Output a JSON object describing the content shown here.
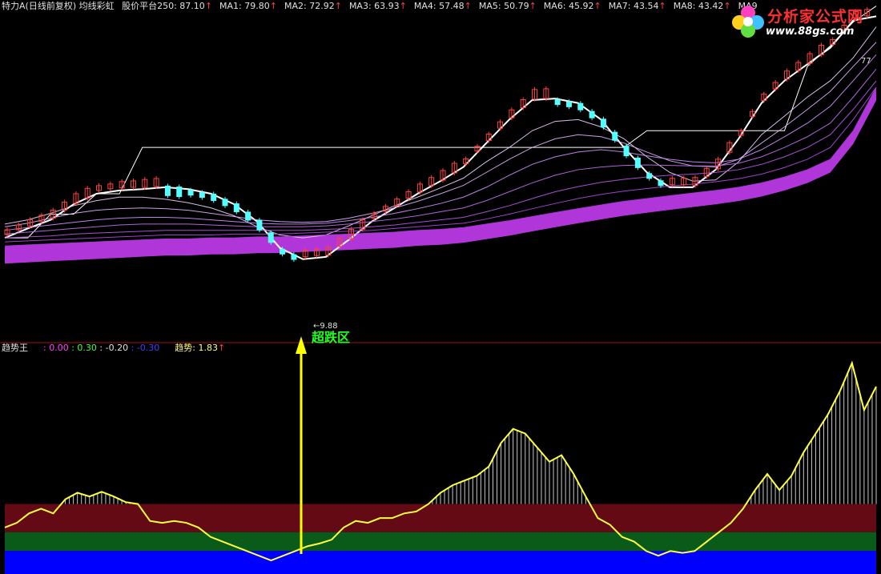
{
  "colors": {
    "background": "#000000",
    "up_candle": "#ff4040",
    "down_candle": "#54ffff",
    "ma_rainbow": "#d040ff",
    "trend_line": "#ffff40",
    "zone_red": "#640a14",
    "zone_green": "#0a5a1a",
    "zone_blue": "#0000ff",
    "arrow": "#ffff00",
    "annotation": "#20ff20"
  },
  "top_header": {
    "title": "特力A(日线前复权) 均线彩虹",
    "items": [
      {
        "label": "股价平台250:",
        "value": "87.10"
      },
      {
        "label": "MA1:",
        "value": "79.80"
      },
      {
        "label": "MA2:",
        "value": "72.92"
      },
      {
        "label": "MA3:",
        "value": "63.93"
      },
      {
        "label": "MA4:",
        "value": "57.48"
      },
      {
        "label": "MA5:",
        "value": "50.79"
      },
      {
        "label": "MA6:",
        "value": "45.92"
      },
      {
        "label": "MA7:",
        "value": "43.54"
      },
      {
        "label": "MA8:",
        "value": "43.42"
      },
      {
        "label": "MA9",
        "value": ""
      }
    ],
    "arrow": "↑"
  },
  "bottom_header": {
    "title": "趋势王",
    "values": [
      {
        "value": ": 0.00",
        "color": "#ff40ff"
      },
      {
        "value": ": 0.30",
        "color": "#40ff40"
      },
      {
        "value": ": -0.20",
        "color": "#e0e0e0"
      },
      {
        "value": ": -0.30",
        "color": "#4040ff"
      }
    ],
    "trend_label": "趋势:",
    "trend_value": "1.83",
    "arrow": "↑"
  },
  "logo": {
    "title": "分析家公式网",
    "url": "www.88gs.com"
  },
  "annotation": "超跌区",
  "price_labels": {
    "low": "9.88",
    "high": "77"
  },
  "chart_data": [
    {
      "type": "line",
      "title": "特力A(日线前复权) 均线彩虹",
      "ylim": [
        5,
        80
      ],
      "series": [
        {
          "name": "股价平台250",
          "values": [
            12,
            12,
            14.7,
            14.7,
            17.5,
            17.5,
            26,
            26,
            26,
            26,
            26,
            26,
            26,
            26,
            26,
            26,
            26,
            26,
            26,
            26,
            26,
            26,
            26,
            26,
            26,
            26,
            26,
            26,
            30,
            30,
            30,
            30,
            30,
            30,
            30,
            52,
            62,
            76,
            87.1
          ]
        },
        {
          "name": "MA1",
          "values": [
            12,
            13,
            14,
            16,
            17.5,
            18,
            18.2,
            18.5,
            18.2,
            17.5,
            16,
            13.8,
            11,
            10,
            10.2,
            11.8,
            13.8,
            15.5,
            17.5,
            19.5,
            22,
            27,
            33,
            39,
            39.5,
            38,
            33,
            26,
            21,
            18.5,
            18.5,
            21.5,
            28,
            38,
            46,
            53,
            61,
            77,
            79.8
          ]
        },
        {
          "name": "MA2",
          "values": [
            13.5,
            14,
            14.8,
            15.8,
            16.5,
            17,
            17,
            16.7,
            16.2,
            15.5,
            14.5,
            13.2,
            12.3,
            12,
            12.3,
            13.3,
            14.5,
            15.8,
            17,
            18.4,
            20,
            23,
            26,
            30,
            32.5,
            33,
            31,
            28,
            24,
            21,
            19.5,
            19.7,
            23,
            29,
            34,
            40,
            46,
            56,
            72.92
          ]
        },
        {
          "name": "MA3",
          "values": [
            13.2,
            13.6,
            14.2,
            14.8,
            15.2,
            15.4,
            15.5,
            15.4,
            15.2,
            14.8,
            14.4,
            14,
            13.8,
            13.7,
            13.8,
            14.2,
            14.8,
            15.5,
            16.4,
            17.5,
            18.8,
            21,
            23.5,
            26,
            28,
            29,
            28.5,
            27,
            25,
            23.2,
            22.2,
            22,
            23.5,
            27,
            31,
            36,
            42,
            52,
            63.93
          ]
        },
        {
          "name": "MA4",
          "values": [
            12.8,
            13.1,
            13.4,
            13.7,
            14,
            14.2,
            14.3,
            14.3,
            14.2,
            14,
            13.8,
            13.6,
            13.5,
            13.5,
            13.6,
            13.9,
            14.3,
            14.8,
            15.4,
            16.1,
            17,
            18.5,
            20.5,
            22.5,
            24,
            25,
            25.5,
            25,
            24.2,
            23.5,
            23,
            22.8,
            23.5,
            25.5,
            28.5,
            32,
            37,
            46,
            57.48
          ]
        },
        {
          "name": "MA5",
          "values": [
            12.4,
            12.6,
            12.8,
            13,
            13.2,
            13.4,
            13.5,
            13.5,
            13.5,
            13.4,
            13.3,
            13.2,
            13.2,
            13.2,
            13.3,
            13.5,
            13.8,
            14.1,
            14.5,
            15,
            15.5,
            16.5,
            17.8,
            19.2,
            20.5,
            21.5,
            22,
            22.3,
            22.4,
            22.3,
            22.2,
            22.2,
            22.7,
            24,
            26,
            28.5,
            32,
            40,
            50.79
          ]
        },
        {
          "name": "MA6",
          "values": [
            12,
            12.1,
            12.2,
            12.4,
            12.5,
            12.6,
            12.7,
            12.8,
            12.8,
            12.8,
            12.8,
            12.8,
            12.8,
            12.8,
            12.9,
            13,
            13.2,
            13.4,
            13.7,
            14,
            14.3,
            15,
            15.8,
            16.8,
            17.8,
            18.6,
            19.3,
            19.8,
            20.2,
            20.5,
            20.7,
            21,
            21.5,
            22.5,
            24,
            26,
            29,
            36,
            45.92
          ]
        },
        {
          "name": "MA7",
          "values": [
            11.6,
            11.7,
            11.8,
            11.9,
            12,
            12.1,
            12.2,
            12.3,
            12.3,
            12.3,
            12.4,
            12.4,
            12.4,
            12.5,
            12.6,
            12.7,
            12.8,
            13,
            13.2,
            13.4,
            13.6,
            14.1,
            14.7,
            15.4,
            16.1,
            16.8,
            17.4,
            17.9,
            18.3,
            18.7,
            19,
            19.4,
            19.9,
            20.7,
            21.9,
            23.5,
            26,
            33,
            43.54
          ]
        },
        {
          "name": "MA8",
          "values": [
            11.2,
            11.3,
            11.4,
            11.5,
            11.6,
            11.7,
            11.8,
            11.9,
            11.9,
            12,
            12,
            12.1,
            12.1,
            12.2,
            12.3,
            12.4,
            12.5,
            12.6,
            12.8,
            12.9,
            13.1,
            13.5,
            13.9,
            14.4,
            14.9,
            15.4,
            15.9,
            16.4,
            16.8,
            17.2,
            17.6,
            18,
            18.5,
            19.2,
            20.2,
            21.5,
            23.5,
            30,
            43.42
          ]
        }
      ]
    },
    {
      "type": "area",
      "title": "趋势王",
      "ylim": [
        -0.3,
        1.83
      ],
      "series": [
        {
          "name": "趋势",
          "values": [
            0.05,
            0.1,
            0.2,
            0.25,
            0.2,
            0.35,
            0.42,
            0.38,
            0.43,
            0.38,
            0.32,
            0.3,
            0.12,
            0.1,
            0.12,
            0.1,
            0.05,
            -0.05,
            -0.1,
            -0.15,
            -0.2,
            -0.25,
            -0.3,
            -0.25,
            -0.2,
            -0.15,
            -0.12,
            -0.08,
            0.05,
            0.12,
            0.1,
            0.15,
            0.15,
            0.2,
            0.22,
            0.3,
            0.42,
            0.5,
            0.55,
            0.6,
            0.7,
            0.95,
            1.1,
            1.05,
            0.9,
            0.75,
            0.82,
            0.62,
            0.38,
            0.15,
            0.08,
            -0.05,
            -0.1,
            -0.2,
            -0.25,
            -0.2,
            -0.22,
            -0.2,
            -0.1,
            0,
            0.1,
            0.25,
            0.45,
            0.62,
            0.45,
            0.6,
            0.85,
            1.05,
            1.25,
            1.5,
            1.8,
            1.3,
            1.55
          ]
        }
      ]
    }
  ]
}
